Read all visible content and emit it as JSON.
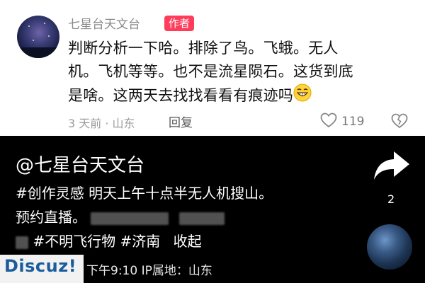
{
  "comment": {
    "username": "七星台天文台",
    "author_badge": "作者",
    "text_line1": "判断分析一下哈。排除了鸟。飞蛾。无人",
    "text_line2": "机。飞机等等。也不是流星陨石。这货到底",
    "text_line3": "是啥。这两天去找找看看有痕迹吗",
    "meta": "3 天前 · 山东",
    "reply_label": "回复",
    "like_count": "119"
  },
  "video": {
    "account": "@七星台天文台",
    "desc_line1": "#创作灵感 明天上午十点半无人机搜山。",
    "desc_line2_start": "预约直播。",
    "desc_line3_tags": "#不明飞行物 #济南",
    "collapse_label": "收起",
    "share_count": "2",
    "time_location": "下午9:10 IP属地：山东"
  },
  "watermark": "Discuz!",
  "icons": [
    "share-icon",
    "heart-icon",
    "broken-heart-icon",
    "laugh-emoji-icon",
    "music-disc-icon",
    "avatar-icon"
  ]
}
